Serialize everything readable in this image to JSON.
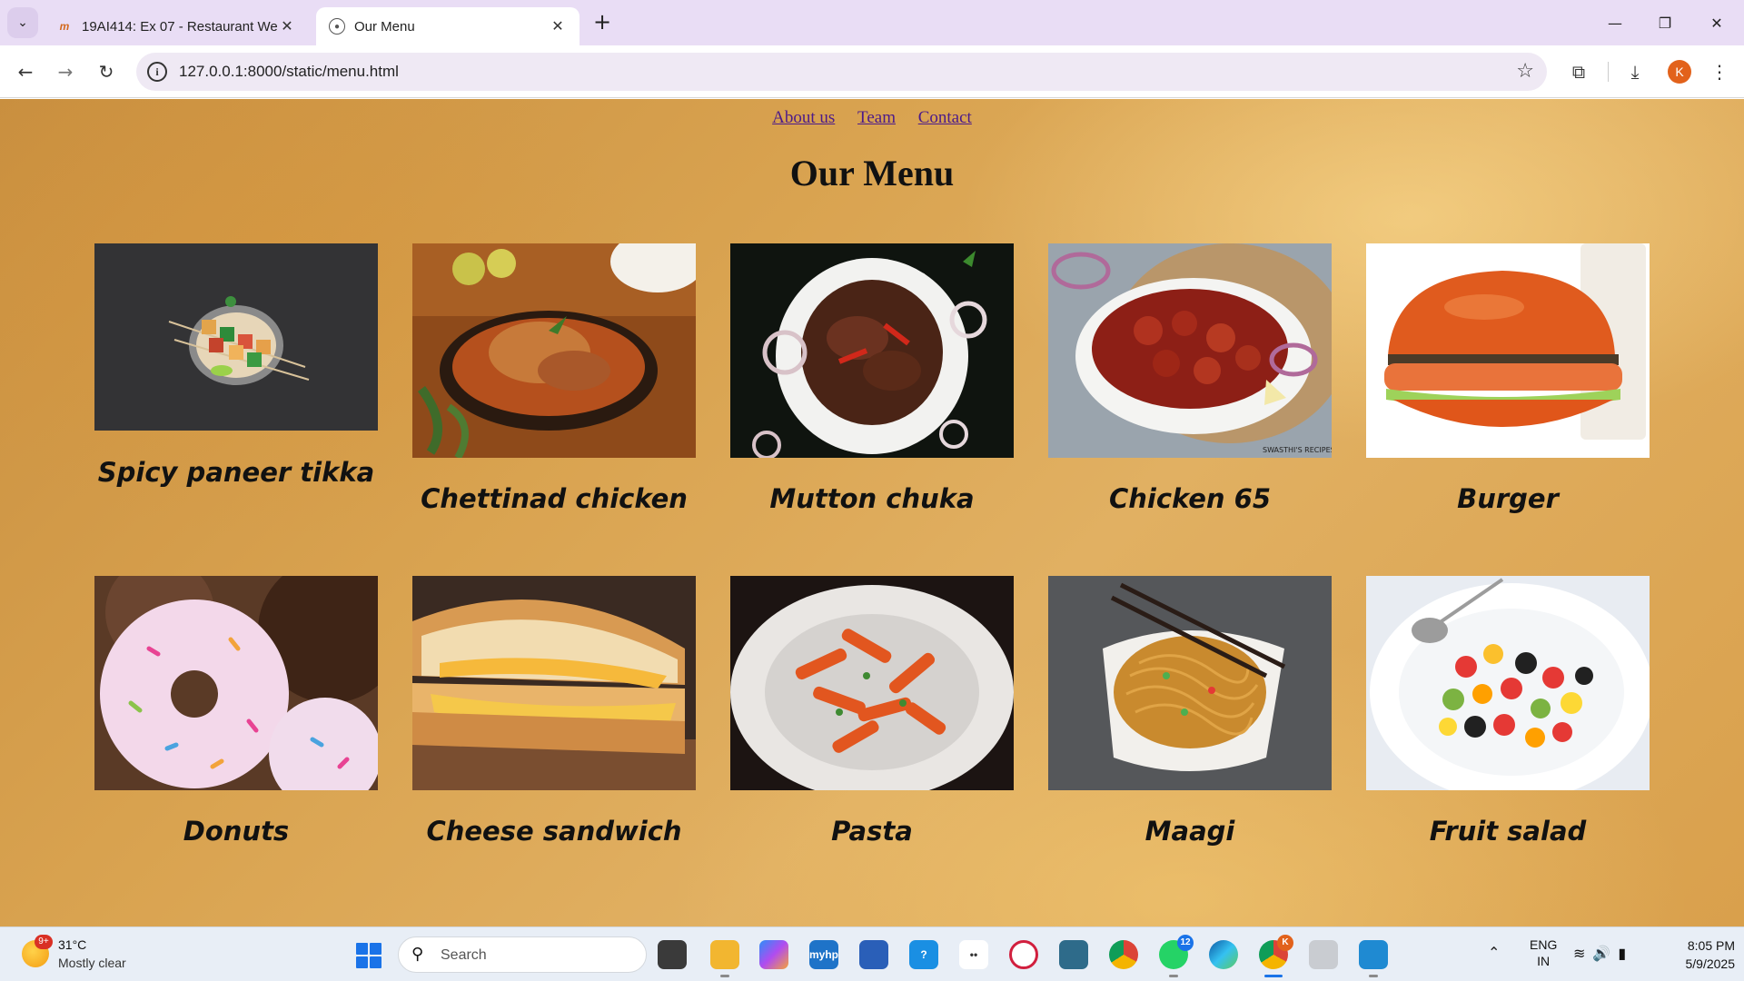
{
  "browser": {
    "tabs": [
      {
        "title": "19AI414: Ex 07 - Restaurant We",
        "active": false,
        "favicon": "moodle-icon"
      },
      {
        "title": "Our Menu",
        "active": true,
        "favicon": "globe-icon"
      }
    ],
    "url": "127.0.0.1:8000/static/menu.html",
    "profile_initial": "K"
  },
  "page": {
    "nav": [
      {
        "label": "About us"
      },
      {
        "label": "Team"
      },
      {
        "label": "Contact"
      }
    ],
    "title": "Our Menu",
    "items": [
      {
        "name": "Spicy paneer tikka",
        "photo": "paneer-tikka-photo"
      },
      {
        "name": "Chettinad chicken",
        "photo": "chettinad-chicken-photo"
      },
      {
        "name": "Mutton chuka",
        "photo": "mutton-chuka-photo"
      },
      {
        "name": "Chicken 65",
        "photo": "chicken-65-photo"
      },
      {
        "name": "Burger",
        "photo": "burger-photo"
      },
      {
        "name": "Donuts",
        "photo": "donuts-photo"
      },
      {
        "name": "Cheese sandwich",
        "photo": "cheese-sandwich-photo"
      },
      {
        "name": "Pasta",
        "photo": "pasta-photo"
      },
      {
        "name": "Maagi",
        "photo": "maagi-photo"
      },
      {
        "name": "Fruit salad",
        "photo": "fruit-salad-photo"
      }
    ],
    "photo_caption": "SWASTHI'S RECIPES"
  },
  "taskbar": {
    "weather_badge": "9+",
    "temperature": "31°C",
    "weather": "Mostly clear",
    "search_placeholder": "Search",
    "whatsapp_badge": "12",
    "chrome_badge": "K",
    "language_line1": "ENG",
    "language_line2": "IN",
    "time": "8:05 PM",
    "date": "5/9/2025",
    "hp_label": "myhp"
  },
  "colors": {
    "page_background": "#d9a350",
    "nav_link": "#4b1a8a",
    "tabstrip": "#e9ddf5",
    "accent": "#1a73e8"
  }
}
